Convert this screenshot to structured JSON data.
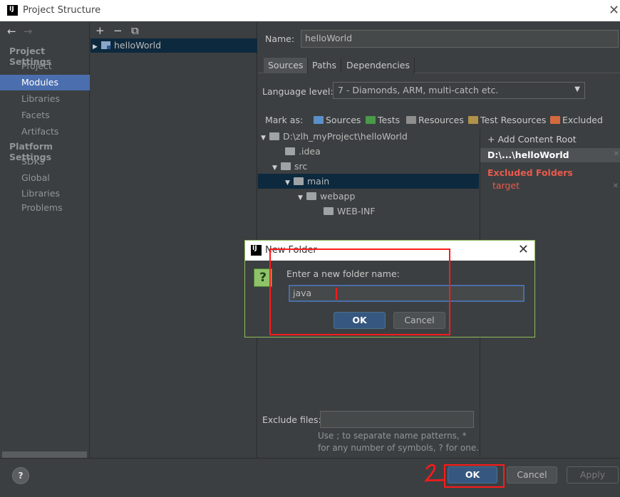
{
  "window": {
    "title": "Project Structure",
    "logo": "IJ"
  },
  "left": {
    "back": "←",
    "forward": "→",
    "project_settings": "Project Settings",
    "platform_settings": "Platform Settings",
    "items_project": [
      "Project",
      "Modules",
      "Libraries",
      "Facets",
      "Artifacts"
    ],
    "items_platform": [
      "SDKs",
      "Global Libraries"
    ],
    "problems": "Problems",
    "selected": "Modules"
  },
  "middle": {
    "add": "+",
    "remove": "−",
    "copy": "⧉",
    "module": "helloWorld"
  },
  "module": {
    "name_label": "Name:",
    "name_value": "helloWorld",
    "tabs": [
      "Sources",
      "Paths",
      "Dependencies"
    ],
    "language_label": "Language level:",
    "language_value": "7 - Diamonds, ARM, multi-catch etc.",
    "mark_as": "Mark as:",
    "marks": [
      "Sources",
      "Tests",
      "Resources",
      "Test Resources",
      "Excluded"
    ],
    "tree": [
      "D:\\zlh_myProject\\helloWorld",
      ".idea",
      "src",
      "main",
      "webapp",
      "WEB-INF"
    ],
    "add_root": "+ Add Content Root",
    "root_path": "D:\\...\\helloWorld",
    "excluded_title": "Excluded Folders",
    "excluded_item": "target",
    "exclude_files_label": "Exclude files:",
    "exclude_files_value": "",
    "hint1": "Use ; to separate name patterns, *",
    "hint2": "for any number of symbols, ? for one."
  },
  "dialog": {
    "title": "New Folder",
    "prompt": "Enter a new folder name:",
    "value": "java",
    "ok": "OK",
    "cancel": "Cancel"
  },
  "footer": {
    "help": "?",
    "ok": "OK",
    "cancel": "Cancel",
    "apply": "Apply"
  },
  "colors": {
    "highlight": "#ff1a1a",
    "selection": "#4b6eaf",
    "excluded": "#ea5a4d"
  }
}
